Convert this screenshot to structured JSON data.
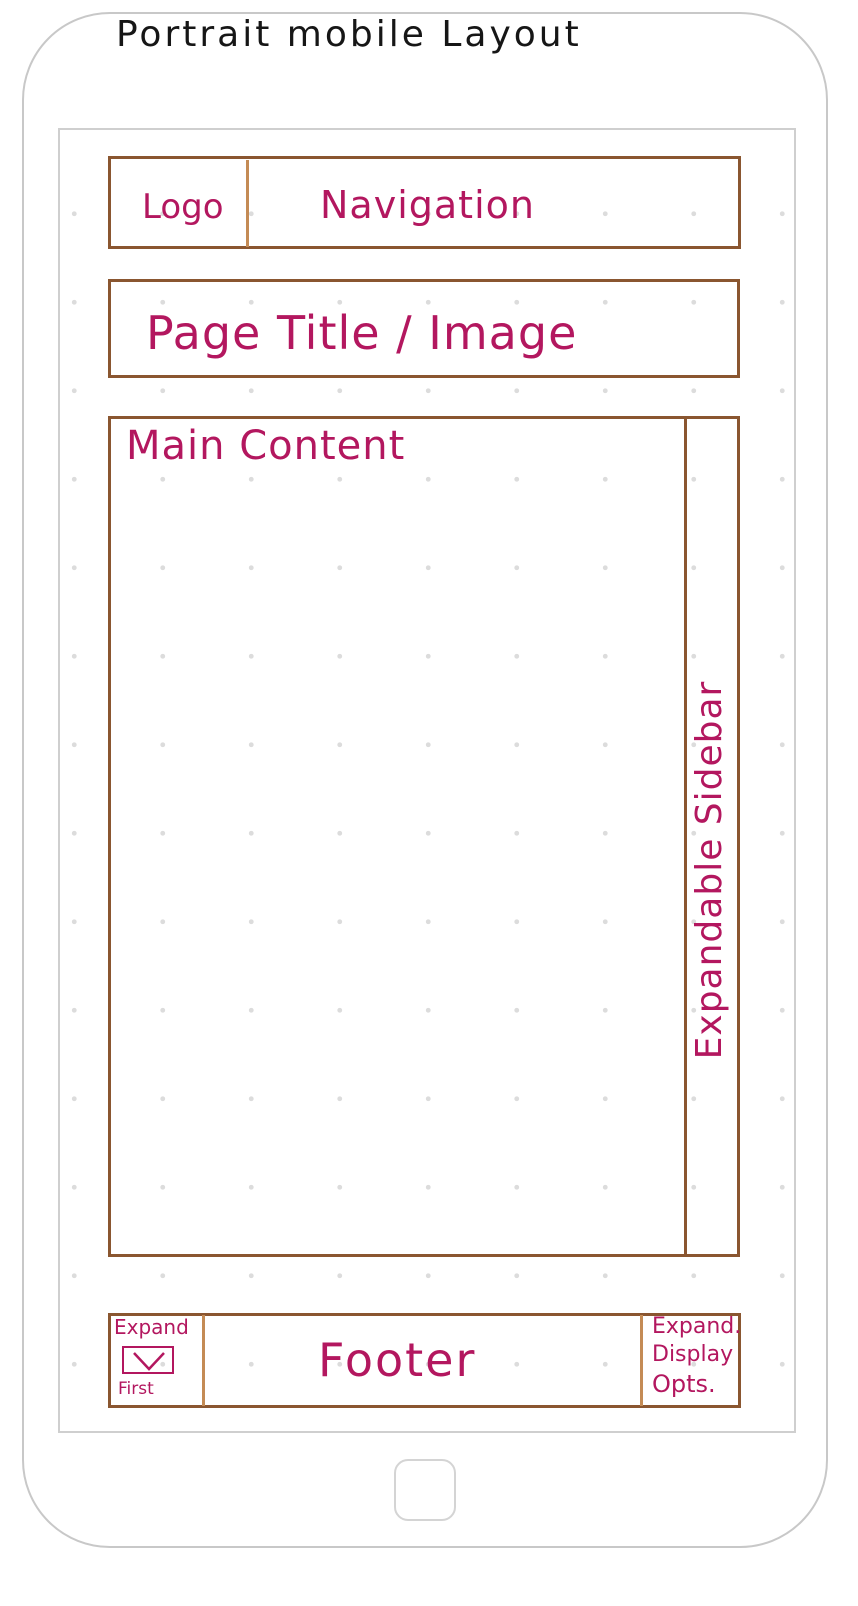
{
  "title": "Portrait mobile Layout",
  "header": {
    "logo_label": "Logo",
    "nav_label": "Navigation"
  },
  "page_title_block": {
    "label": "Page Title / Image"
  },
  "main": {
    "label": "Main Content"
  },
  "sidebar": {
    "label": "Expandable Sidebar"
  },
  "footer": {
    "label": "Footer",
    "left_control": {
      "top_label": "Expand",
      "bottom_label": "First"
    },
    "right_control": {
      "lines": [
        "Expand.",
        "Display",
        "Opts."
      ]
    }
  },
  "colors": {
    "outline": "#8a5630",
    "annotation": "#b3175f",
    "device": "#c8c8c8"
  }
}
